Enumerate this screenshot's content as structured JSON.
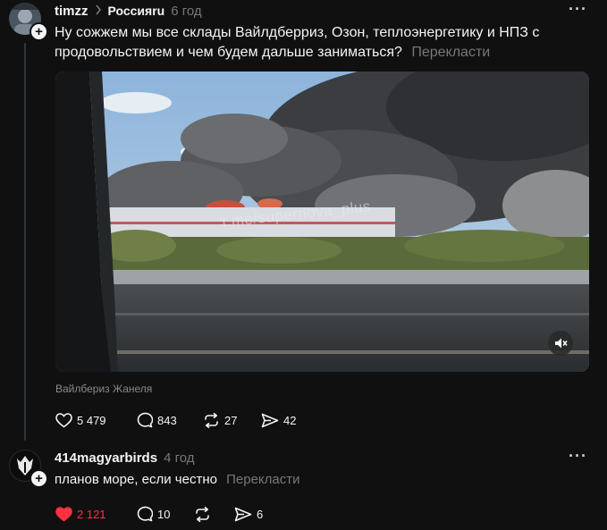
{
  "post": {
    "username": "timzz",
    "community": "Россияru",
    "time": "6 год",
    "text": "Ну сожжем мы все склады Вайлдберриз, Озон, теплоэнергетику и НПЗ с продовольствием и чем будем дальше заниматься?",
    "translate_label": "Перекласти",
    "media": {
      "watermark": "t.me/supernova_plus",
      "caption": "Вайлбериз Жанеля"
    },
    "stats": {
      "likes": "5 479",
      "replies": "843",
      "reposts": "27",
      "shares": "42"
    }
  },
  "reply": {
    "username": "414magyarbirds",
    "time": "4 год",
    "text": "планов море, если честно",
    "translate_label": "Перекласти",
    "stats": {
      "likes": "2 121",
      "replies": "10",
      "reposts": "",
      "shares": "6"
    }
  },
  "colors": {
    "background": "#101010",
    "text": "#f3f5f7",
    "muted": "#777777",
    "like_active": "#ff3040"
  },
  "icons": [
    "more-icon",
    "plus-icon",
    "heart-icon",
    "comment-icon",
    "repost-icon",
    "share-icon",
    "mute-icon",
    "chevron-right-icon"
  ]
}
